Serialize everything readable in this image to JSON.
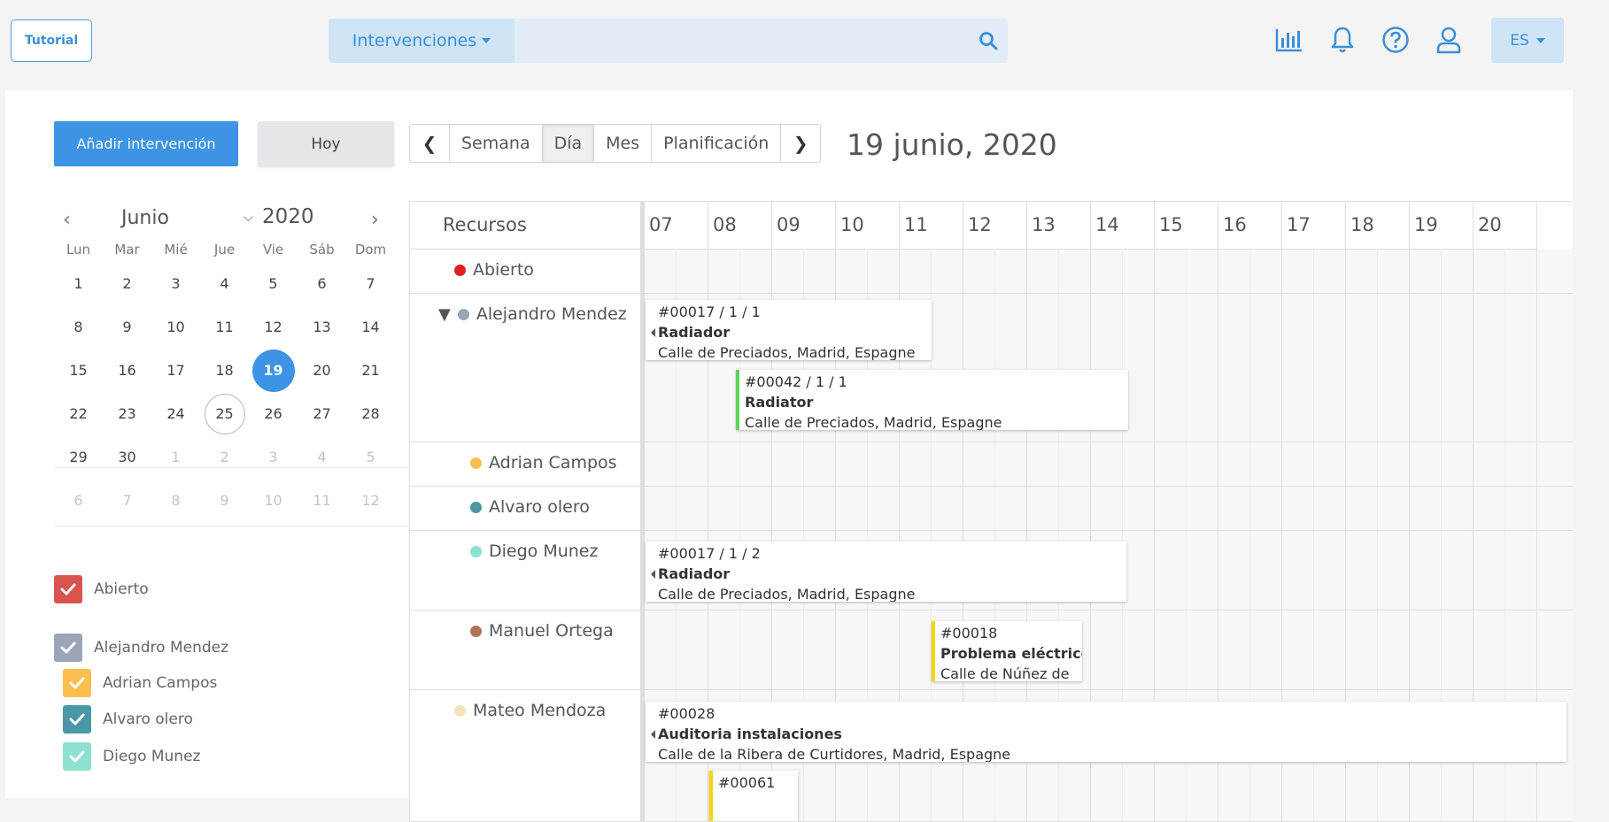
{
  "topbar": {
    "tutorial": "Tutorial",
    "search_dropdown": "Intervenciones",
    "search_placeholder": "",
    "lang": "ES",
    "icons": [
      "stats-icon",
      "bell-icon",
      "help-icon",
      "user-icon",
      "search-icon"
    ]
  },
  "toolbar": {
    "add": "Añadir intervención",
    "today": "Hoy",
    "prev": "❮",
    "next": "❯",
    "views": [
      "Semana",
      "Día",
      "Mes",
      "Planificación"
    ],
    "active_view": "Día",
    "current_date": "19 junio, 2020"
  },
  "minical": {
    "month": "Junio",
    "year": "2020",
    "dow": [
      "Lun",
      "Mar",
      "Mié",
      "Jue",
      "Vie",
      "Sáb",
      "Dom"
    ],
    "weeks": [
      [
        "1",
        "2",
        "3",
        "4",
        "5",
        "6",
        "7"
      ],
      [
        "8",
        "9",
        "10",
        "11",
        "12",
        "13",
        "14"
      ],
      [
        "15",
        "16",
        "17",
        "18",
        "19",
        "20",
        "21"
      ],
      [
        "22",
        "23",
        "24",
        "25",
        "26",
        "27",
        "28"
      ],
      [
        "29",
        "30",
        "1",
        "2",
        "3",
        "4",
        "5"
      ],
      [
        "6",
        "7",
        "8",
        "9",
        "10",
        "11",
        "12"
      ]
    ],
    "selected": "19",
    "today_outline": "25"
  },
  "filters": [
    {
      "label": "Abierto",
      "color": "#d9534f"
    },
    {
      "label": "Alejandro Mendez",
      "color": "#9aa5b8"
    },
    {
      "label": "Adrian Campos",
      "color": "#f9c04f"
    },
    {
      "label": "Alvaro olero",
      "color": "#4a97a8"
    },
    {
      "label": "Diego Munez",
      "color": "#8ee0cf"
    }
  ],
  "planner": {
    "resources_header": "Recursos",
    "hours": [
      "07",
      "08",
      "09",
      "10",
      "11",
      "12",
      "13",
      "14",
      "15",
      "16",
      "17",
      "18",
      "19",
      "20"
    ],
    "resources": [
      {
        "name": "Abierto",
        "color": "#e02020"
      },
      {
        "name": "Alejandro Mendez",
        "color": "#9aa5b8",
        "expanded": true
      },
      {
        "name": "Adrian Campos",
        "color": "#f9c04f"
      },
      {
        "name": "Alvaro olero",
        "color": "#4a97a8"
      },
      {
        "name": "Diego Munez",
        "color": "#8ee0cf"
      },
      {
        "name": "Manuel Ortega",
        "color": "#b0735a"
      },
      {
        "name": "Mateo Mendoza",
        "color": "#f2e4bd"
      }
    ],
    "events": [
      {
        "id": "#00017 / 1 / 1",
        "title": "Radiador",
        "address": "Calle de Preciados, Madrid, Espagne"
      },
      {
        "id": "#00042 / 1 / 1",
        "title": "Radiator",
        "address": "Calle de Preciados, Madrid, Espagne",
        "bar_color": "#5cd65c"
      },
      {
        "id": "#00017 / 1 / 2",
        "title": "Radiador",
        "address": "Calle de Preciados, Madrid, Espagne"
      },
      {
        "id": "#00018",
        "title": "Problema eléctrico",
        "address": "Calle de Núñez de",
        "bar_color": "#f5d60a"
      },
      {
        "id": "#00028",
        "title": "Auditoria instalaciones",
        "address": "Calle de la Ribera de Curtidores, Madrid, Espagne"
      },
      {
        "id": "#00061",
        "title": "",
        "address": "",
        "bar_color": "#f5d60a"
      }
    ]
  }
}
